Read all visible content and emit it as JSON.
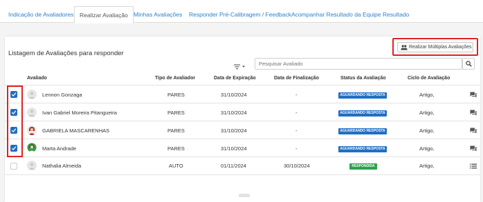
{
  "tabs": [
    {
      "label": "Indicação de Avaliadores"
    },
    {
      "label": "Realizar Avaliação"
    },
    {
      "label": "Minhas Avaliações"
    },
    {
      "label": "Responder Pré-Calibragem / Feedback"
    },
    {
      "label": "Acompanhar Resultado da Equipe"
    },
    {
      "label": "Resultado"
    }
  ],
  "page": {
    "title": "Listagem de Avaliações para responder",
    "multi_button_label": "Realizar Múltiplas Avaliações",
    "search_placeholder": "Pesquisar Avaliado"
  },
  "table": {
    "headers": {
      "avaliado": "Avaliado",
      "tipo": "Tipo de Avaliador",
      "expiracao": "Data de Expiração",
      "finalizacao": "Data de Finalização",
      "status": "Status da Avaliação",
      "ciclo": "Ciclo de Avaliação"
    },
    "rows": [
      {
        "checked": true,
        "name": "Lennon Gonzaga",
        "tipo": "PARES",
        "expiracao": "31/10/2024",
        "finalizacao": "-",
        "status": "AGUARDANDO RESPOSTA",
        "ciclo": "Artigo,",
        "icon": "chat-icon"
      },
      {
        "checked": true,
        "name": "Ivan Gabriel Moreira Pitangueira",
        "tipo": "PARES",
        "expiracao": "31/10/2024",
        "finalizacao": "-",
        "status": "AGUARDANDO RESPOSTA",
        "ciclo": "Artigo,",
        "icon": "chat-icon"
      },
      {
        "checked": true,
        "name": "GABRIELA MASCARENHAS",
        "tipo": "PARES",
        "expiracao": "31/10/2024",
        "finalizacao": "-",
        "status": "AGUARDANDO RESPOSTA",
        "ciclo": "Artigo,",
        "icon": "chat-icon"
      },
      {
        "checked": true,
        "name": "Marta Andrade",
        "tipo": "PARES",
        "expiracao": "31/10/2024",
        "finalizacao": "-",
        "status": "AGUARDANDO RESPOSTA",
        "ciclo": "Artigo,",
        "icon": "chat-icon"
      },
      {
        "checked": false,
        "name": "Nathalia Almeida",
        "tipo": "AUTO",
        "expiracao": "01/11/2024",
        "finalizacao": "30/10/2024",
        "status": "RESPONDIDA",
        "ciclo": "Artigo,",
        "icon": "list-icon"
      }
    ]
  },
  "colors": {
    "link": "#2f80c8",
    "primary": "#1f6fc5",
    "success": "#2ba24c",
    "highlight": "#e02020"
  }
}
